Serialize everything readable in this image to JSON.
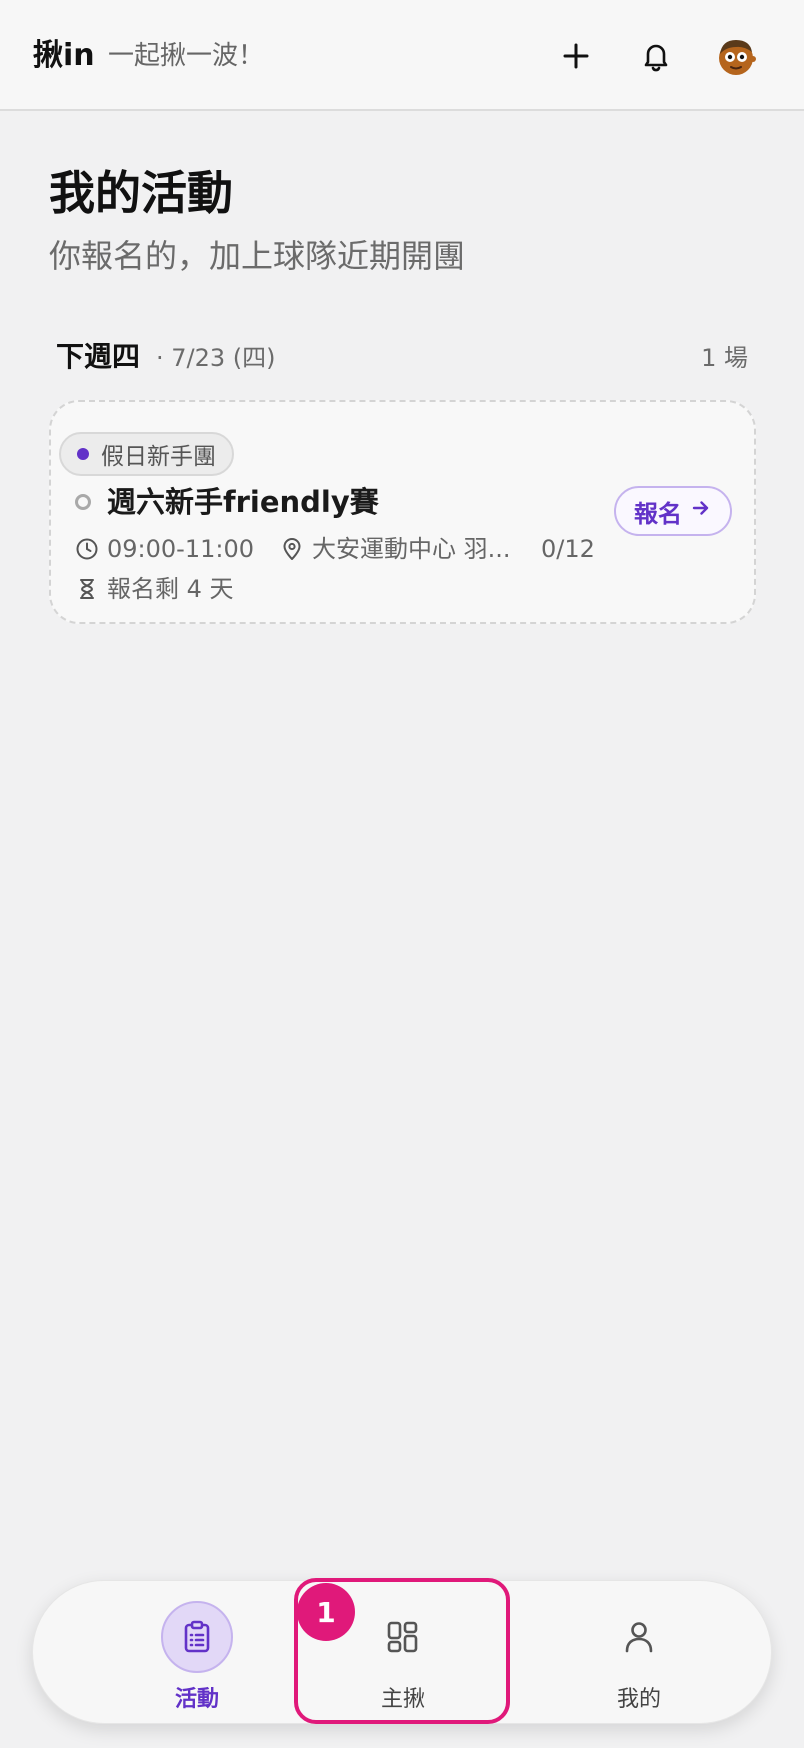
{
  "header": {
    "brand": "揪in",
    "tagline": "一起揪一波！",
    "icons": {
      "create": "plus-icon",
      "notifications": "bell-icon",
      "profile": "avatar"
    }
  },
  "page": {
    "title": "我的活動",
    "subtitle": "你報名的，加上球隊近期開團"
  },
  "section": {
    "day": "下週四",
    "date": "· 7/23 (四)",
    "count": "1 場"
  },
  "event": {
    "group": "假日新手團",
    "title": "週六新手friendly賽",
    "time": "09:00-11:00",
    "place": "大安運動中心 羽...",
    "capacity": "0/12",
    "deadline": "報名剩 4 天",
    "signup_label": "報名",
    "accent_color": "#6232c8"
  },
  "nav": {
    "items": [
      {
        "label": "活動",
        "icon": "clipboard-icon",
        "active": true
      },
      {
        "label": "主揪",
        "icon": "grid-icon",
        "active": false
      },
      {
        "label": "我的",
        "icon": "user-icon",
        "active": false
      }
    ]
  },
  "annotation": {
    "badge": "1",
    "color": "#e0197a"
  }
}
